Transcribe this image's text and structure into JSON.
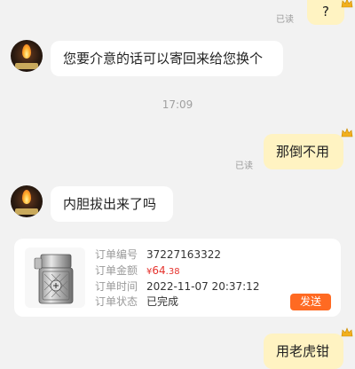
{
  "messages": {
    "top_right_text": "?",
    "top_read": "已读",
    "left_1": "您要介意的话可以寄回来给您换个",
    "time_1": "17:09",
    "right_1": "那倒不用",
    "right_1_read": "已读",
    "left_2": "内胆拔出来了吗",
    "right_2": "用老虎钳"
  },
  "order": {
    "number_label": "订单编号",
    "number_value": "37227163322",
    "amount_label": "订单金额",
    "amount_currency": "¥",
    "amount_int": "64",
    "amount_dec": ".38",
    "time_label": "订单时间",
    "time_value": "2022-11-07 20:37:12",
    "status_label": "订单状态",
    "status_value": "已完成",
    "send_label": "发送"
  },
  "colors": {
    "bubble_self": "#fff3c2",
    "bubble_other": "#ffffff",
    "accent": "#ff6a22",
    "price": "#e5322d",
    "background": "#f2f2f2"
  }
}
